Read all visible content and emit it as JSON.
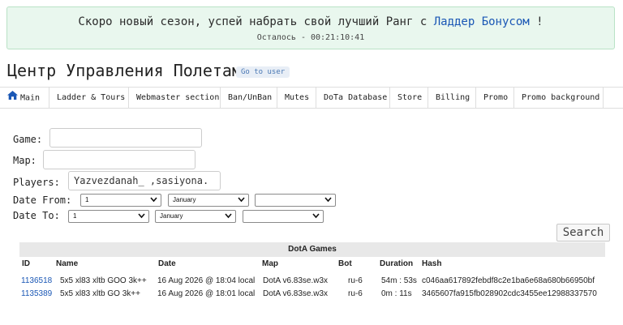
{
  "banner": {
    "text_before": "Скоро новый сезон, успей набрать свой лучший Ранг с ",
    "link": "Ладдер Бонусом",
    "text_after": " !",
    "timer": "Осталось - 00:21:10:41",
    "bg_color": "#e9f7ee",
    "link_color": "#1a57b5"
  },
  "header": {
    "title": "Центр Управления Полетами",
    "goto_user": "Go to user"
  },
  "nav": {
    "items": [
      {
        "label": "Main",
        "icon": "home-icon"
      },
      {
        "label": "Ladder & Tours"
      },
      {
        "label": "Webmaster section"
      },
      {
        "label": "Ban/UnBan"
      },
      {
        "label": "Mutes"
      },
      {
        "label": "DoTa Database"
      },
      {
        "label": "Store"
      },
      {
        "label": "Billing"
      },
      {
        "label": "Promo"
      },
      {
        "label": "Promo background"
      }
    ],
    "accent_color": "#1a57b5"
  },
  "form": {
    "game_label": "Game:",
    "game_value": "",
    "map_label": "Map:",
    "map_value": "",
    "players_label": "Players:",
    "players_value": "Yazvezdanah_ ,sasiyona.",
    "date_from_label": "Date From:",
    "date_to_label": "Date To:",
    "date_from": {
      "day": "1",
      "month": "January",
      "year": ""
    },
    "date_to": {
      "day": "1",
      "month": "January",
      "year": ""
    },
    "search_button": "Search"
  },
  "games": {
    "title": "DotA Games",
    "columns": [
      "ID",
      "Name",
      "Date",
      "Map",
      "Bot",
      "Duration",
      "Hash"
    ],
    "rows": [
      {
        "id": "1136518",
        "name": "5x5 xl83 xltb GOO 3k++",
        "date": "16 Aug 2026 @ 18:04 local",
        "map": "DotA v6.83se.w3x",
        "bot": "ru-6",
        "duration": "54m : 53s",
        "hash": "c046aa617892febdf8c2e1ba6e68a680b66950bf"
      },
      {
        "id": "1135389",
        "name": "5x5 xl83 xltb GO 3k++",
        "date": "16 Aug 2026 @ 18:01 local",
        "map": "DotA v6.83se.w3x",
        "bot": "ru-6",
        "duration": "0m : 11s",
        "hash": "3465607fa915fb028902cdc3455ee12988337570"
      }
    ]
  }
}
